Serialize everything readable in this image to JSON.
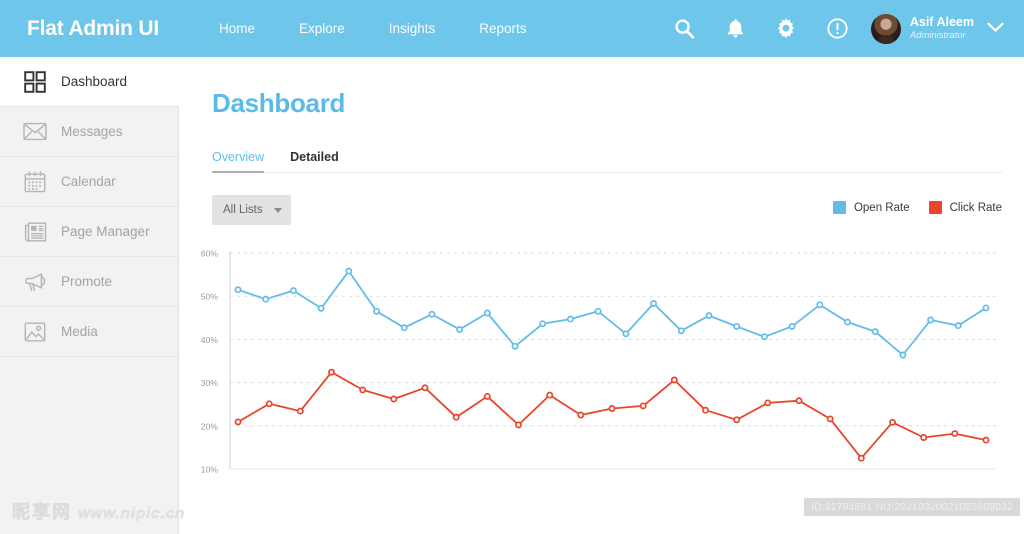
{
  "header": {
    "brand": "Flat Admin UI",
    "nav": [
      {
        "label": "Home"
      },
      {
        "label": "Explore"
      },
      {
        "label": "Insights"
      },
      {
        "label": "Reports"
      }
    ],
    "icons": [
      {
        "name": "search-icon"
      },
      {
        "name": "bell-icon"
      },
      {
        "name": "gear-icon"
      },
      {
        "name": "alert-circle-icon"
      }
    ],
    "user": {
      "name": "Asif Aleem",
      "role": "Administrator",
      "avatar_name": "avatar",
      "caret_name": "chevron-down-icon"
    },
    "bg_color": "#6ec6ea"
  },
  "sidebar": {
    "items": [
      {
        "label": "Dashboard",
        "icon": "grid-icon",
        "active": true
      },
      {
        "label": "Messages",
        "icon": "envelope-icon",
        "active": false
      },
      {
        "label": "Calendar",
        "icon": "calendar-icon",
        "active": false
      },
      {
        "label": "Page Manager",
        "icon": "newspaper-icon",
        "active": false
      },
      {
        "label": "Promote",
        "icon": "megaphone-icon",
        "active": false
      },
      {
        "label": "Media",
        "icon": "image-icon",
        "active": false
      }
    ]
  },
  "main": {
    "page_title": "Dashboard",
    "title_color": "#5bbbe8",
    "tabs": [
      {
        "label": "Overview",
        "active": true
      },
      {
        "label": "Detailed",
        "active": false
      }
    ],
    "filter": {
      "selected": "All Lists",
      "options": [
        "All Lists"
      ]
    }
  },
  "chart_data": {
    "type": "line",
    "title": "",
    "xlabel": "",
    "ylabel": "",
    "ylim": [
      10,
      60
    ],
    "y_ticks": [
      60,
      50,
      40,
      30,
      20,
      10
    ],
    "y_tick_labels": [
      "60%",
      "50%",
      "40%",
      "30%",
      "20%",
      "10%"
    ],
    "grid": true,
    "grid_style": "dashed-horizontal",
    "legend_position": "top-right",
    "x": [
      1,
      2,
      3,
      4,
      5,
      6,
      7,
      8,
      9,
      10,
      11,
      12,
      13,
      14,
      15,
      16,
      17,
      18,
      19,
      20,
      21,
      22,
      23,
      24,
      25,
      26
    ],
    "series": [
      {
        "name": "Open Rate",
        "color": "#63bce8",
        "values": [
          51.5,
          49.3,
          51.3,
          47.2,
          55.8,
          46.5,
          42.7,
          45.8,
          42.3,
          46.1,
          38.4,
          43.6,
          44.7,
          46.5,
          41.3,
          48.3,
          42.0,
          45.5,
          43.0,
          40.6,
          43.0,
          48.0,
          44.0,
          41.8,
          36.4,
          44.5,
          43.2,
          47.3
        ]
      },
      {
        "name": "Click Rate",
        "color": "#e8452a",
        "values": [
          20.9,
          25.1,
          23.4,
          32.4,
          28.3,
          26.2,
          28.8,
          22.0,
          26.8,
          20.2,
          27.1,
          22.5,
          24.0,
          24.6,
          30.6,
          23.6,
          21.4,
          25.3,
          25.8,
          21.6,
          12.5,
          20.8,
          17.3,
          18.2,
          16.7
        ]
      }
    ]
  },
  "legend": [
    {
      "label": "Open Rate",
      "color": "#63bce8"
    },
    {
      "label": "Click Rate",
      "color": "#e8452a"
    }
  ],
  "footer": {
    "watermark_cn": "昵享网",
    "watermark_url": "www.nipic.cn",
    "id_text": "ID:31794581 NO:20210320021053609032"
  }
}
